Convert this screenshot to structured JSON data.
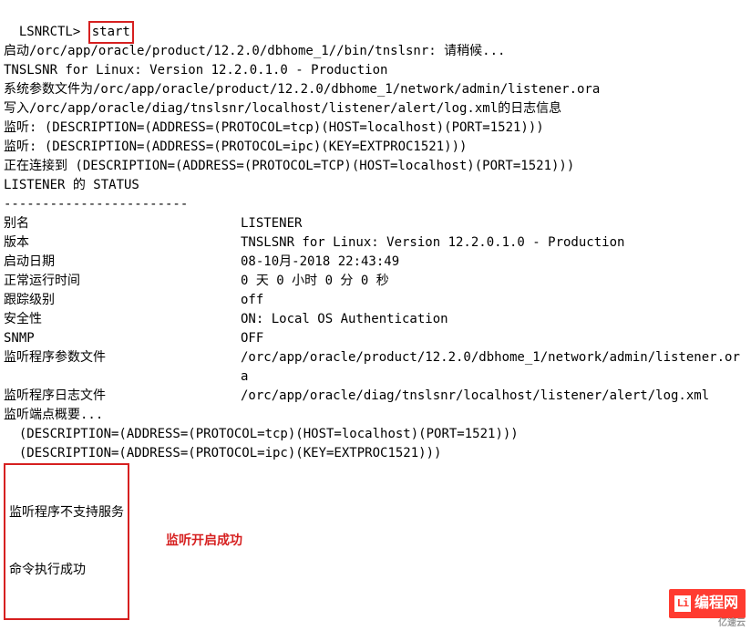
{
  "prompt": "LSNRCTL> ",
  "command": "start",
  "lines": {
    "l1": "启动/orc/app/oracle/product/12.2.0/dbhome_1//bin/tnslsnr: 请稍候...",
    "blank": "",
    "l2": "TNSLSNR for Linux: Version 12.2.0.1.0 - Production",
    "l3": "系统参数文件为/orc/app/oracle/product/12.2.0/dbhome_1/network/admin/listener.ora",
    "l4": "写入/orc/app/oracle/diag/tnslsnr/localhost/listener/alert/log.xml的日志信息",
    "l5": "监听: (DESCRIPTION=(ADDRESS=(PROTOCOL=tcp)(HOST=localhost)(PORT=1521)))",
    "l6": "监听: (DESCRIPTION=(ADDRESS=(PROTOCOL=ipc)(KEY=EXTPROC1521)))",
    "l7": "正在连接到 (DESCRIPTION=(ADDRESS=(PROTOCOL=TCP)(HOST=localhost)(PORT=1521)))",
    "l8": "LISTENER 的 STATUS",
    "sep": "------------------------",
    "kv": [
      {
        "label": "别名",
        "value": "LISTENER"
      },
      {
        "label": "版本",
        "value": "TNSLSNR for Linux: Version 12.2.0.1.0 - Production"
      },
      {
        "label": "启动日期",
        "value": "08-10月-2018 22:43:49"
      },
      {
        "label": "正常运行时间",
        "value": "0 天 0 小时 0 分 0 秒"
      },
      {
        "label": "跟踪级别",
        "value": "off"
      },
      {
        "label": "安全性",
        "value": "ON: Local OS Authentication"
      },
      {
        "label": "SNMP",
        "value": "OFF"
      },
      {
        "label": "监听程序参数文件",
        "value": "/orc/app/oracle/product/12.2.0/dbhome_1/network/admin/listener.ora"
      },
      {
        "label": "监听程序日志文件",
        "value": "/orc/app/oracle/diag/tnslsnr/localhost/listener/alert/log.xml"
      }
    ],
    "l9": "监听端点概要...",
    "l10": "  (DESCRIPTION=(ADDRESS=(PROTOCOL=tcp)(HOST=localhost)(PORT=1521)))",
    "l11": "  (DESCRIPTION=(ADDRESS=(PROTOCOL=ipc)(KEY=EXTPROC1521)))",
    "box1": "监听程序不支持服务",
    "box2": "命令执行成功",
    "note": "监听开启成功"
  },
  "watermark": {
    "logo": "Li",
    "text": "编程网",
    "sub": "亿速云"
  }
}
